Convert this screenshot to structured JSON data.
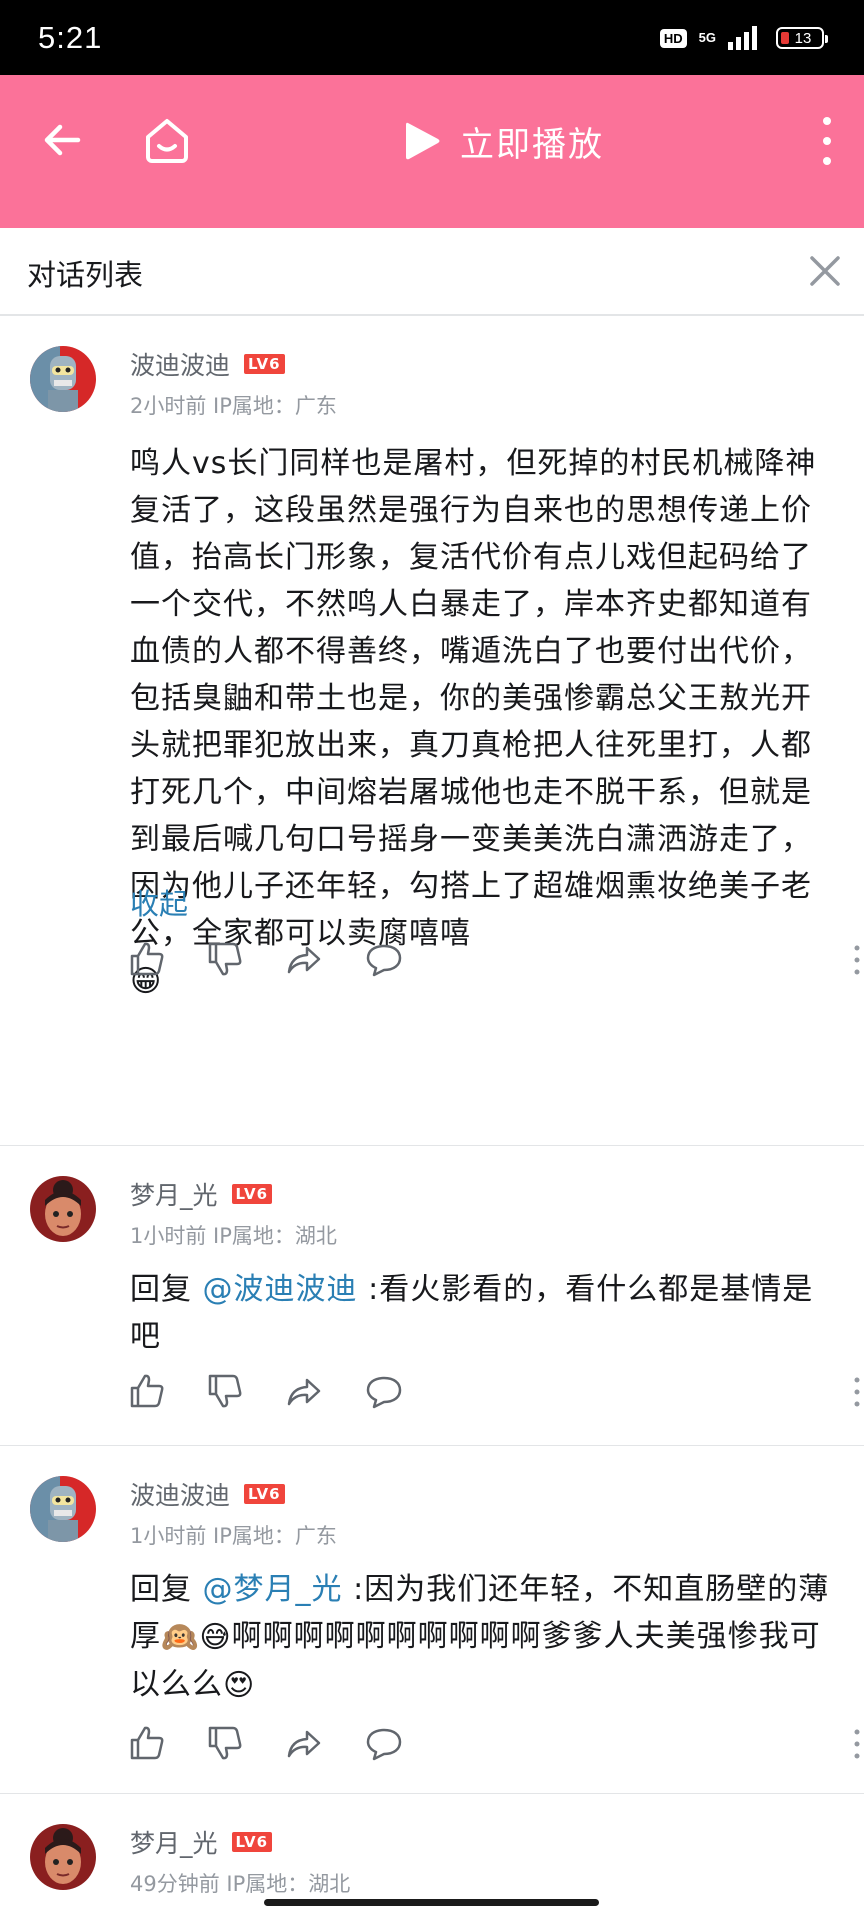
{
  "status_bar": {
    "time": "5:21",
    "hd": "HD",
    "network": "5G",
    "battery": "13"
  },
  "top_bar": {
    "play_label": "立即播放",
    "bg_color": "#fb7299"
  },
  "panel": {
    "title": "对话列表"
  },
  "comments": [
    {
      "username": "波迪波迪",
      "level": "LV6",
      "meta": "2小时前 IP属地：广东",
      "text": "鸣人vs长门同样也是屠村，但死掉的村民机械降神复活了，这段虽然是强行为自来也的思想传递上价值，抬高长门形象，复活代价有点儿戏但起码给了一个交代，不然鸣人白暴走了，岸本齐史都知道有血债的人都不得善终，嘴遁洗白了也要付出代价，包括臭鼬和带土也是，你的美强惨霸总父王敖光开头就把罪犯放出来，真刀真枪把人往死里打，人都打死几个，中间熔岩屠城他也走不脱干系，但就是到最后喊几句口号摇身一变美美洗白潇洒游走了，因为他儿子还年轻，勾搭上了超雄烟熏妆绝美子老公，全家都可以卖腐嘻嘻",
      "emoji_end": "😁",
      "collapse_label": "收起"
    },
    {
      "username": "梦月_光",
      "level": "LV6",
      "meta": "1小时前 IP属地：湖北",
      "reply_prefix": "回复 ",
      "mention": "@波迪波迪",
      "text": " :看火影看的，看什么都是基情是吧"
    },
    {
      "username": "波迪波迪",
      "level": "LV6",
      "meta": "1小时前 IP属地：广东",
      "reply_prefix": "回复 ",
      "mention": "@梦月_光",
      "text_part1": " :因为我们还年轻，不知直肠壁的薄厚",
      "emoji_a": "🙉",
      "emoji_b": "😅",
      "text_part2": "啊啊啊啊啊啊啊啊啊啊爹爹人夫美强惨我可以么么",
      "emoji_c": "😍"
    },
    {
      "username": "梦月_光",
      "level": "LV6",
      "meta": "49分钟前 IP属地：湖北"
    }
  ],
  "icons": {
    "back": "back-arrow-icon",
    "home": "home-icon",
    "play": "play-icon",
    "more": "more-vertical-icon",
    "close": "close-icon",
    "like": "thumbs-up-icon",
    "dislike": "thumbs-down-icon",
    "share": "share-icon",
    "reply": "comment-bubble-icon"
  }
}
